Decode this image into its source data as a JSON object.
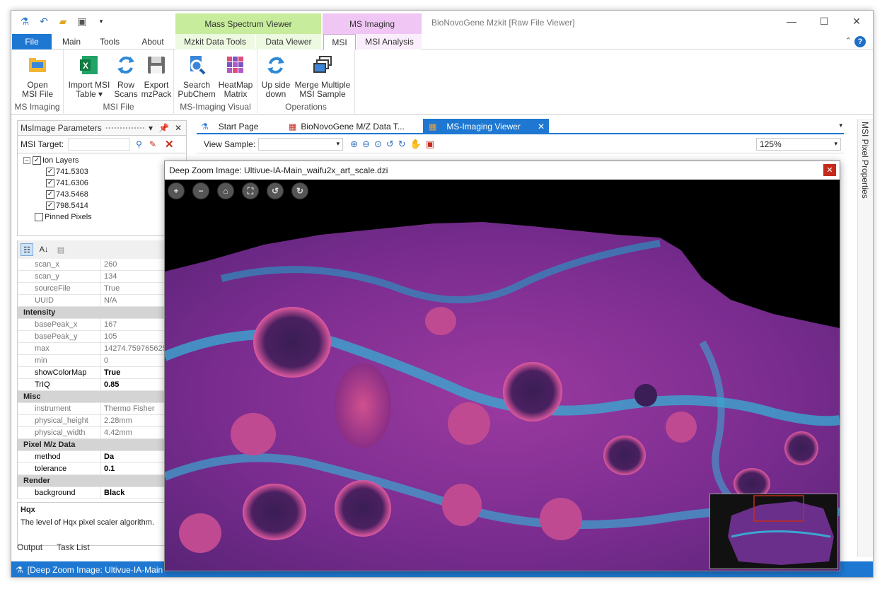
{
  "window": {
    "title": "BioNovoGene Mzkit [Raw File Viewer]",
    "contextual_groups": [
      "Mass Spectrum Viewer",
      "MS Imaging"
    ]
  },
  "menu_tabs": [
    "File",
    "Main",
    "Tools",
    "About",
    "Mzkit Data Tools",
    "Data Viewer",
    "MSI",
    "MSI Analysis"
  ],
  "ribbon": {
    "groups": [
      {
        "caption": "MS Imaging",
        "buttons": [
          {
            "label1": "Open",
            "label2": "MSI File"
          }
        ]
      },
      {
        "caption": "MSI File",
        "buttons": [
          {
            "label1": "Import MSI",
            "label2": "Table ▾"
          },
          {
            "label1": "Row",
            "label2": "Scans"
          },
          {
            "label1": "Export",
            "label2": "mzPack"
          }
        ]
      },
      {
        "caption": "MS-Imaging Visual",
        "buttons": [
          {
            "label1": "Search",
            "label2": "PubChem"
          },
          {
            "label1": "HeatMap",
            "label2": "Matrix"
          }
        ]
      },
      {
        "caption": "Operations",
        "buttons": [
          {
            "label1": "Up side",
            "label2": "down"
          },
          {
            "label1": "Merge Multiple",
            "label2": "MSI Sample"
          }
        ]
      }
    ]
  },
  "left_panel": {
    "title": "MsImage Parameters",
    "target_label": "MSI Target:",
    "tree": {
      "root": "Ion Layers",
      "layers": [
        "741.5303",
        "741.6306",
        "743.5468",
        "798.5414"
      ],
      "pinned": "Pinned Pixels"
    },
    "properties": [
      {
        "type": "row",
        "key": "scan_x",
        "value": "260"
      },
      {
        "type": "row",
        "key": "scan_y",
        "value": "134"
      },
      {
        "type": "row",
        "key": "sourceFile",
        "value": "True"
      },
      {
        "type": "row",
        "key": "UUID",
        "value": "N/A"
      },
      {
        "type": "cat",
        "key": "Intensity"
      },
      {
        "type": "row",
        "key": "basePeak_x",
        "value": "167"
      },
      {
        "type": "row",
        "key": "basePeak_y",
        "value": "105"
      },
      {
        "type": "row",
        "key": "max",
        "value": "14274.759765625"
      },
      {
        "type": "row",
        "key": "min",
        "value": "0"
      },
      {
        "type": "row",
        "key": "showColorMap",
        "value": "True",
        "bold": true
      },
      {
        "type": "row",
        "key": "TrIQ",
        "value": "0.85",
        "bold": true
      },
      {
        "type": "cat",
        "key": "Misc"
      },
      {
        "type": "row",
        "key": "instrument",
        "value": "Thermo Fisher"
      },
      {
        "type": "row",
        "key": "physical_height",
        "value": "2.28mm"
      },
      {
        "type": "row",
        "key": "physical_width",
        "value": "4.42mm"
      },
      {
        "type": "cat",
        "key": "Pixel M/z Data"
      },
      {
        "type": "row",
        "key": "method",
        "value": "Da",
        "bold": true
      },
      {
        "type": "row",
        "key": "tolerance",
        "value": "0.1",
        "bold": true
      },
      {
        "type": "cat",
        "key": "Render"
      },
      {
        "type": "row",
        "key": "background",
        "value": "Black",
        "bold": true
      }
    ],
    "desc_title": "Hqx",
    "desc_text": "The level of Hqx pixel scaler algorithm.",
    "bottom_tabs": [
      "Output",
      "Task List"
    ]
  },
  "doc_tabs": [
    "Start Page",
    "BioNovoGene M/Z Data T...",
    "MS-Imaging Viewer"
  ],
  "viewer": {
    "view_sample_label": "View Sample:",
    "zoom": "125%"
  },
  "right_panel_title": "MSI Pixel Properties",
  "deep_zoom": {
    "title": "Deep Zoom Image: Ultivue-IA-Main_waifu2x_art_scale.dzi"
  },
  "status": "[Deep Zoom Image: Ultivue-IA-Main",
  "colors": {
    "accent": "#1e78d2",
    "ctx_green": "#c6ec9c",
    "ctx_purple": "#efc6f4",
    "close_red": "#c42b1c"
  }
}
